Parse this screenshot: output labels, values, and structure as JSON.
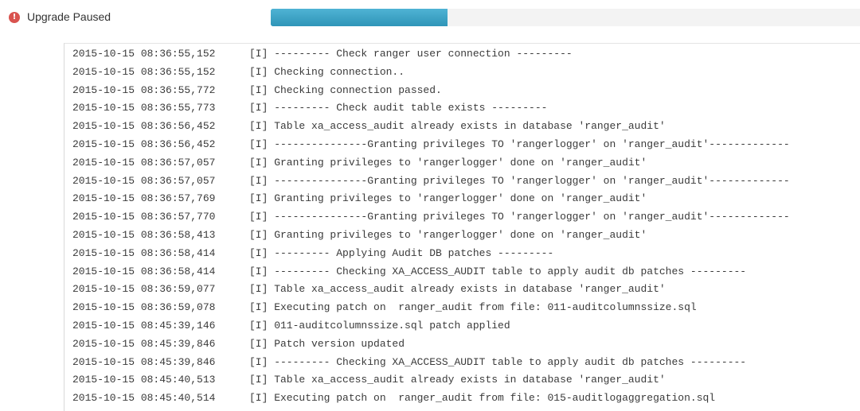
{
  "status": {
    "text": "Upgrade Paused",
    "icon": "exclamation-circle-icon",
    "icon_color": "#d9534f"
  },
  "progress": {
    "value_percent": 30,
    "color": "#3aa6c8"
  },
  "log": {
    "lines": [
      {
        "timestamp": "2015-10-15 08:36:55,152",
        "message": "[I] --------- Check ranger user connection ---------"
      },
      {
        "timestamp": "2015-10-15 08:36:55,152",
        "message": "[I] Checking connection.."
      },
      {
        "timestamp": "2015-10-15 08:36:55,772",
        "message": "[I] Checking connection passed."
      },
      {
        "timestamp": "2015-10-15 08:36:55,773",
        "message": "[I] --------- Check audit table exists ---------"
      },
      {
        "timestamp": "2015-10-15 08:36:56,452",
        "message": "[I] Table xa_access_audit already exists in database 'ranger_audit'"
      },
      {
        "timestamp": "2015-10-15 08:36:56,452",
        "message": "[I] ---------------Granting privileges TO 'rangerlogger' on 'ranger_audit'-------------"
      },
      {
        "timestamp": "2015-10-15 08:36:57,057",
        "message": "[I] Granting privileges to 'rangerlogger' done on 'ranger_audit'"
      },
      {
        "timestamp": "2015-10-15 08:36:57,057",
        "message": "[I] ---------------Granting privileges TO 'rangerlogger' on 'ranger_audit'-------------"
      },
      {
        "timestamp": "2015-10-15 08:36:57,769",
        "message": "[I] Granting privileges to 'rangerlogger' done on 'ranger_audit'"
      },
      {
        "timestamp": "2015-10-15 08:36:57,770",
        "message": "[I] ---------------Granting privileges TO 'rangerlogger' on 'ranger_audit'-------------"
      },
      {
        "timestamp": "2015-10-15 08:36:58,413",
        "message": "[I] Granting privileges to 'rangerlogger' done on 'ranger_audit'"
      },
      {
        "timestamp": "2015-10-15 08:36:58,414",
        "message": "[I] --------- Applying Audit DB patches ---------"
      },
      {
        "timestamp": "2015-10-15 08:36:58,414",
        "message": "[I] --------- Checking XA_ACCESS_AUDIT table to apply audit db patches ---------"
      },
      {
        "timestamp": "2015-10-15 08:36:59,077",
        "message": "[I] Table xa_access_audit already exists in database 'ranger_audit'"
      },
      {
        "timestamp": "2015-10-15 08:36:59,078",
        "message": "[I] Executing patch on  ranger_audit from file: 011-auditcolumnssize.sql"
      },
      {
        "timestamp": "2015-10-15 08:45:39,146",
        "message": "[I] 011-auditcolumnssize.sql patch applied"
      },
      {
        "timestamp": "2015-10-15 08:45:39,846",
        "message": "[I] Patch version updated"
      },
      {
        "timestamp": "2015-10-15 08:45:39,846",
        "message": "[I] --------- Checking XA_ACCESS_AUDIT table to apply audit db patches ---------"
      },
      {
        "timestamp": "2015-10-15 08:45:40,513",
        "message": "[I] Table xa_access_audit already exists in database 'ranger_audit'"
      },
      {
        "timestamp": "2015-10-15 08:45:40,514",
        "message": "[I] Executing patch on  ranger_audit from file: 015-auditlogaggregation.sql"
      }
    ]
  }
}
